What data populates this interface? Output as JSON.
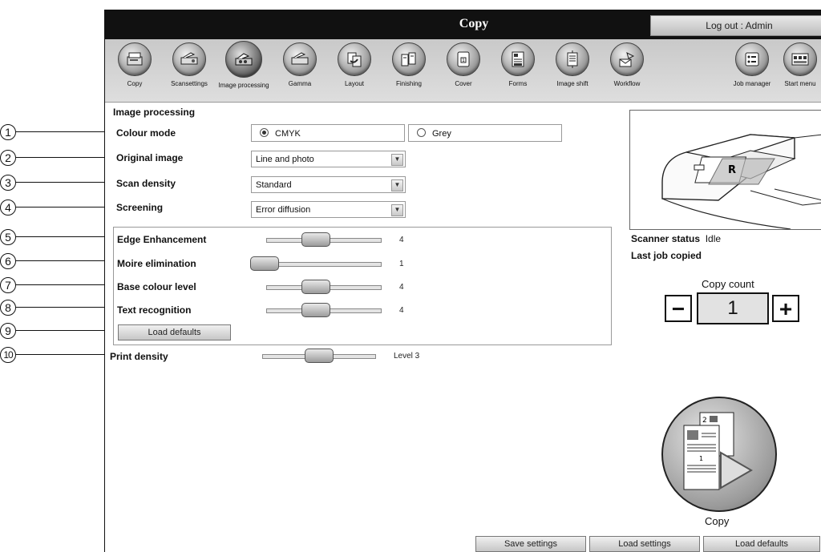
{
  "callouts": [
    "1",
    "2",
    "3",
    "4",
    "5",
    "6",
    "7",
    "8",
    "9",
    "10"
  ],
  "window": {
    "title": "Copy",
    "logout_label": "Log out : Admin"
  },
  "toolbar": {
    "items": [
      "Copy",
      "Scansettings",
      "Image processing",
      "Gamma",
      "Layout",
      "Finishing",
      "Cover",
      "Forms",
      "Image shift",
      "Workflow",
      "Job manager",
      "Start menu"
    ],
    "active": "Image processing"
  },
  "section": {
    "heading": "Image processing"
  },
  "colour_mode": {
    "label": "Colour mode",
    "options": [
      "CMYK",
      "Grey"
    ],
    "selected": "CMYK"
  },
  "original_image": {
    "label": "Original image",
    "value": "Line and photo"
  },
  "scan_density": {
    "label": "Scan density",
    "value": "Standard"
  },
  "screening": {
    "label": "Screening",
    "value": "Error diffusion"
  },
  "sliders": [
    {
      "label": "Edge Enhancement",
      "value": "4",
      "level": 0.5
    },
    {
      "label": "Moire elimination",
      "value": "1",
      "level": 0
    },
    {
      "label": "Base colour level",
      "value": "4",
      "level": 0.5
    },
    {
      "label": "Text recognition",
      "value": "4",
      "level": 0.5
    }
  ],
  "load_defaults_inner": "Load defaults",
  "print_density": {
    "label": "Print density",
    "value": "Level 3",
    "level": 0.5
  },
  "scanner": {
    "status_label": "Scanner status",
    "status_value": "Idle",
    "last_job_label": "Last job copied"
  },
  "copy_count": {
    "label": "Copy count",
    "value": "1",
    "minus": "−",
    "plus": "+"
  },
  "copy_button": {
    "label": "Copy"
  },
  "footer": {
    "save": "Save settings",
    "load": "Load settings",
    "defaults": "Load defaults"
  }
}
